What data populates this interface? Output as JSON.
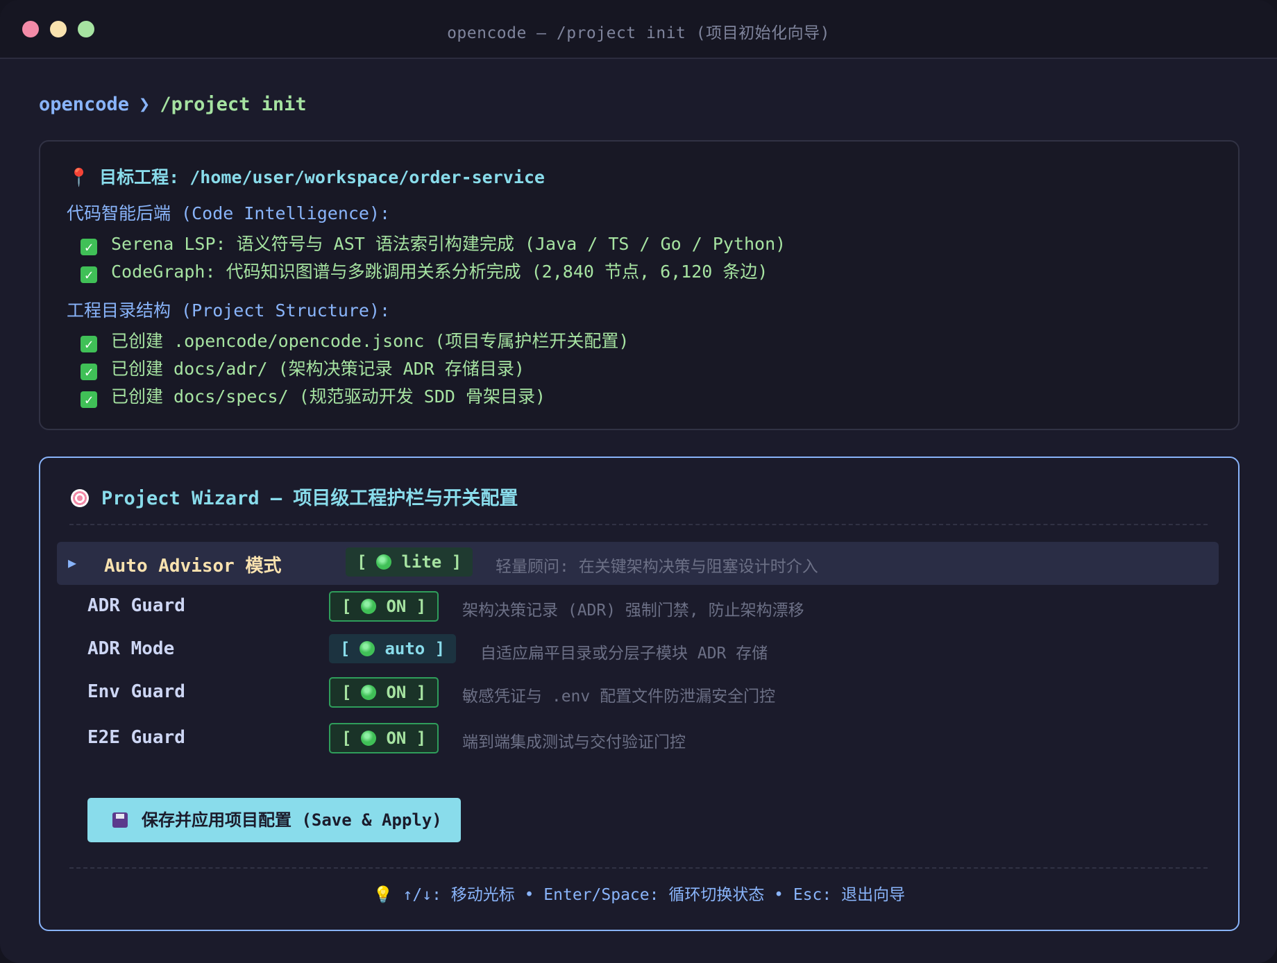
{
  "window": {
    "title": "opencode — /project init (项目初始化向导)"
  },
  "prompt": {
    "app": "opencode",
    "arrow": "❯",
    "command": "/project init"
  },
  "info": {
    "target_label": "目标工程: /home/user/workspace/order-service",
    "code_intel_title": "代码智能后端 (Code Intelligence):",
    "code_intel_items": [
      "Serena LSP: 语义符号与 AST 语法索引构建完成 (Java / TS / Go / Python)",
      "CodeGraph: 代码知识图谱与多跳调用关系分析完成 (2,840 节点, 6,120 条边)"
    ],
    "structure_title": "工程目录结构 (Project Structure):",
    "structure_items": [
      "已创建 .opencode/opencode.jsonc (项目专属护栏开关配置)",
      "已创建 docs/adr/ (架构决策记录 ADR 存储目录)",
      "已创建 docs/specs/ (规范驱动开发 SDD 骨架目录)"
    ]
  },
  "wizard": {
    "title": "Project Wizard — 项目级工程护栏与开关配置",
    "options": [
      {
        "label": "Auto Advisor 模式",
        "value": "lite",
        "desc": "轻量顾问: 在关键架构决策与阻塞设计时介入"
      },
      {
        "label": "ADR Guard",
        "value": "ON",
        "desc": "架构决策记录 (ADR) 强制门禁, 防止架构漂移"
      },
      {
        "label": "ADR Mode",
        "value": "auto",
        "desc": "自适应扁平目录或分层子模块 ADR 存储"
      },
      {
        "label": "Env Guard",
        "value": "ON",
        "desc": "敏感凭证与 .env 配置文件防泄漏安全门控"
      },
      {
        "label": "E2E Guard",
        "value": "ON",
        "desc": "端到端集成测试与交付验证门控"
      }
    ],
    "save_button": "保存并应用项目配置 (Save & Apply)",
    "hint": "↑/↓: 移动光标 • Enter/Space: 循环切换状态 • Esc: 退出向导"
  },
  "colors": {
    "accent": "#89b4fa",
    "success": "#a6e3a1",
    "cyan": "#89dceb",
    "highlight": "#f9e2af"
  }
}
